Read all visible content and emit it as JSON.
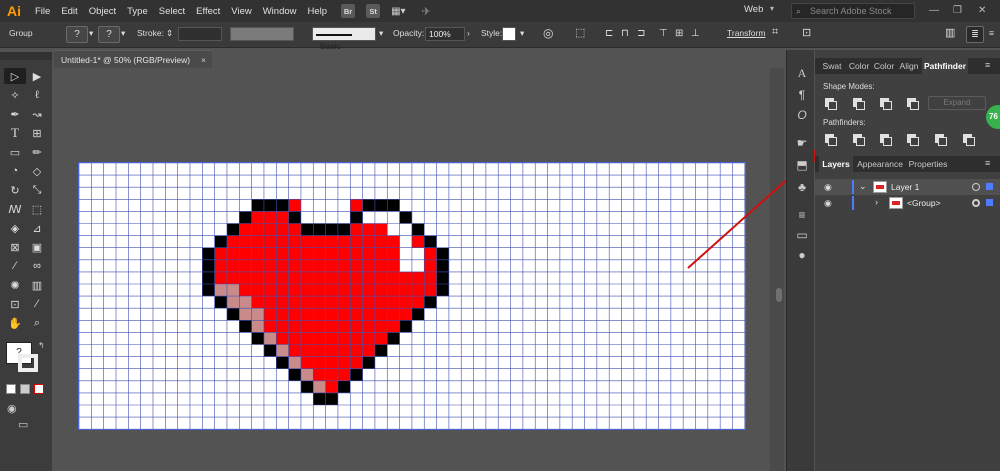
{
  "app": {
    "logo": "Ai"
  },
  "menu": [
    "File",
    "Edit",
    "Object",
    "Type",
    "Select",
    "Effect",
    "View",
    "Window",
    "Help"
  ],
  "menu_badges": [
    "Br",
    "St"
  ],
  "workspace": "Web",
  "search": {
    "placeholder": "Search Adobe Stock"
  },
  "control_bar": {
    "selection": "Group",
    "stroke_label": "Stroke:",
    "brush": "Basic",
    "opacity_label": "Opacity:",
    "opacity_value": "100%",
    "style_label": "Style:",
    "transform": "Transform"
  },
  "document_tab": {
    "title": "Untitled-1* @ 50% (RGB/Preview)",
    "close": "×"
  },
  "panel_tabs": [
    {
      "label": "Swat",
      "active": false
    },
    {
      "label": "Color",
      "active": false
    },
    {
      "label": "Color",
      "active": false
    },
    {
      "label": "Align",
      "active": false
    },
    {
      "label": "Pathfinder",
      "active": true
    }
  ],
  "pathfinder": {
    "shape_modes_label": "Shape Modes:",
    "pathfinders_label": "Pathfinders:",
    "expand": "Expand"
  },
  "badge": "76",
  "layers_tabs": [
    {
      "label": "Layers",
      "active": true
    },
    {
      "label": "Appearance",
      "active": false
    },
    {
      "label": "Properties",
      "active": false
    }
  ],
  "layers": [
    {
      "name": "Layer 1",
      "expanded": true
    },
    {
      "name": "<Group>",
      "expanded": false
    }
  ],
  "colors": {
    "heart_red": "#ff0000",
    "heart_outline": "#000000",
    "heart_shade": "#c98a8a",
    "grid_line": "#3f4fb0",
    "arrow": "#d01010",
    "layer_color": "#4d7cff"
  },
  "heart": {
    "outline_cells": [
      [
        14,
        3
      ],
      [
        15,
        3
      ],
      [
        16,
        3
      ],
      [
        23,
        3
      ],
      [
        24,
        3
      ],
      [
        25,
        3
      ],
      [
        13,
        4
      ],
      [
        17,
        4
      ],
      [
        22,
        4
      ],
      [
        26,
        4
      ],
      [
        12,
        5
      ],
      [
        18,
        5
      ],
      [
        19,
        5
      ],
      [
        20,
        5
      ],
      [
        21,
        5
      ],
      [
        27,
        5
      ],
      [
        11,
        6
      ],
      [
        28,
        6
      ],
      [
        10,
        7
      ],
      [
        29,
        7
      ],
      [
        10,
        8
      ],
      [
        29,
        8
      ],
      [
        10,
        9
      ],
      [
        29,
        9
      ],
      [
        10,
        10
      ],
      [
        29,
        10
      ],
      [
        11,
        11
      ],
      [
        28,
        11
      ],
      [
        12,
        12
      ],
      [
        27,
        12
      ],
      [
        13,
        13
      ],
      [
        26,
        13
      ],
      [
        14,
        14
      ],
      [
        25,
        14
      ],
      [
        15,
        15
      ],
      [
        24,
        15
      ],
      [
        16,
        16
      ],
      [
        23,
        16
      ],
      [
        17,
        17
      ],
      [
        22,
        17
      ],
      [
        18,
        18
      ],
      [
        21,
        18
      ],
      [
        19,
        19
      ],
      [
        20,
        19
      ]
    ],
    "white_cells": [
      [
        23,
        4
      ],
      [
        24,
        4
      ],
      [
        25,
        4
      ],
      [
        25,
        5
      ],
      [
        26,
        5
      ],
      [
        26,
        6
      ],
      [
        26,
        7
      ],
      [
        27,
        7
      ],
      [
        27,
        8
      ],
      [
        26,
        8
      ]
    ],
    "shade_cells": [
      [
        11,
        10
      ],
      [
        12,
        11
      ],
      [
        13,
        12
      ],
      [
        14,
        13
      ],
      [
        15,
        14
      ],
      [
        16,
        15
      ],
      [
        17,
        16
      ],
      [
        18,
        17
      ],
      [
        19,
        18
      ],
      [
        12,
        10
      ],
      [
        13,
        11
      ],
      [
        14,
        12
      ]
    ]
  }
}
